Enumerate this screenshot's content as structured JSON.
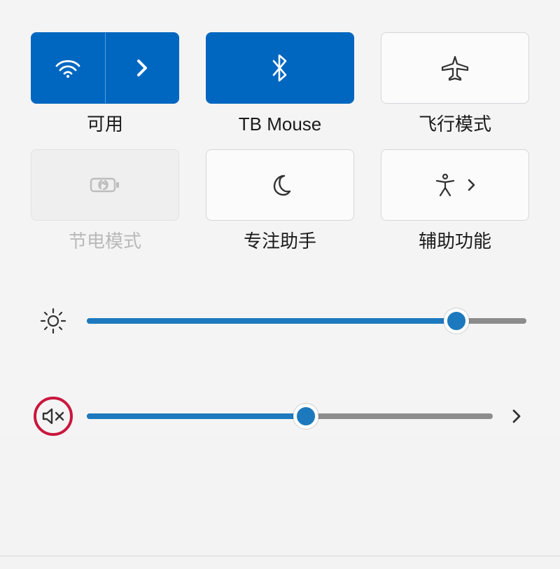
{
  "tiles": {
    "wifi": {
      "label": "可用",
      "active": true,
      "disabled": false,
      "has_expand": true
    },
    "bluetooth": {
      "label": "TB Mouse",
      "active": true,
      "disabled": false,
      "has_expand": false
    },
    "airplane": {
      "label": "飞行模式",
      "active": false,
      "disabled": false,
      "has_expand": false
    },
    "battery_saver": {
      "label": "节电模式",
      "active": false,
      "disabled": true,
      "has_expand": false
    },
    "focus_assist": {
      "label": "专注助手",
      "active": false,
      "disabled": false,
      "has_expand": false
    },
    "accessibility": {
      "label": "辅助功能",
      "active": false,
      "disabled": false,
      "has_expand": true
    }
  },
  "sliders": {
    "brightness": {
      "value": 84,
      "has_more": false,
      "highlighted": false
    },
    "volume": {
      "value": 54,
      "has_more": true,
      "highlighted": true,
      "muted": true
    }
  },
  "colors": {
    "accent": "#0067c0",
    "slider_fill": "#1d79bd",
    "highlight_ring": "#c9173d"
  }
}
